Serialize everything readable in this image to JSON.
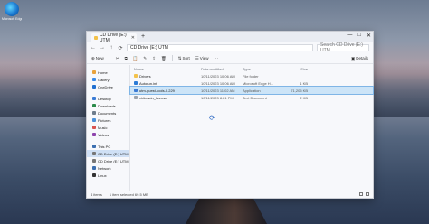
{
  "desktop": {
    "icon_label": "Microsoft Edge"
  },
  "window": {
    "tab_title": "CD Drive (E:) UTM",
    "new_tab": "+",
    "controls": {
      "minimize": "—",
      "maximize": "□",
      "close": "✕"
    }
  },
  "address": {
    "back": "←",
    "forward": "→",
    "up": "↑",
    "refresh": "⟳",
    "path": "CD Drive (E:) UTM",
    "search_placeholder": "Search CD Drive (E:) UTM"
  },
  "toolbar": {
    "new_label": "New",
    "cut": "✂",
    "copy": "⧉",
    "paste": "📋",
    "rename": "✎",
    "share": "⇪",
    "delete": "🗑",
    "sort_label": "Sort",
    "view_label": "View",
    "more": "···",
    "details_label": "Details"
  },
  "sidebar": {
    "items": [
      {
        "label": "Home",
        "color": "#e9a23b"
      },
      {
        "label": "Gallery",
        "color": "#3b8be9"
      },
      {
        "label": "OneDrive",
        "color": "#1f6fd1"
      },
      {
        "label": "Desktop",
        "color": "#3a7bd5"
      },
      {
        "label": "Downloads",
        "color": "#2a8a4a"
      },
      {
        "label": "Documents",
        "color": "#6d7c8c"
      },
      {
        "label": "Pictures",
        "color": "#4a90d9"
      },
      {
        "label": "Music",
        "color": "#d9534f"
      },
      {
        "label": "Videos",
        "color": "#8e44ad"
      },
      {
        "label": "This PC",
        "color": "#3b6fb0"
      },
      {
        "label": "CD Drive (E:) UTM",
        "color": "#777777"
      },
      {
        "label": "CD Drive (E:) UTM",
        "color": "#777777"
      },
      {
        "label": "Network",
        "color": "#3b6fb0"
      },
      {
        "label": "Linux",
        "color": "#333333"
      }
    ]
  },
  "files": {
    "headers": {
      "name": "Name",
      "date": "Date modified",
      "type": "Type",
      "size": "Size"
    },
    "rows": [
      {
        "name": "Drivers",
        "date": "10/11/2023 10:06 AM",
        "type": "File folder",
        "size": "",
        "icon_color": "#f3c24b"
      },
      {
        "name": "Autorun.inf",
        "date": "10/11/2023 10:06 AM",
        "type": "Microsoft Edge H...",
        "size": "1 KB",
        "icon_color": "#2b7bd6"
      },
      {
        "name": "utm-guest-tools-0.229",
        "date": "10/11/2023 11:02 AM",
        "type": "Application",
        "size": "71,205 KB",
        "icon_color": "#3a7bd5"
      },
      {
        "name": "virtio-win_license",
        "date": "10/11/2023 8:21 PM",
        "type": "Text Document",
        "size": "2 KB",
        "icon_color": "#9aa3ad"
      }
    ]
  },
  "status": {
    "item_count": "4 items",
    "selected": "1 item selected  69.5 MB"
  },
  "colors": {
    "accent": "#0067c0",
    "selection": "#cce4f7"
  }
}
